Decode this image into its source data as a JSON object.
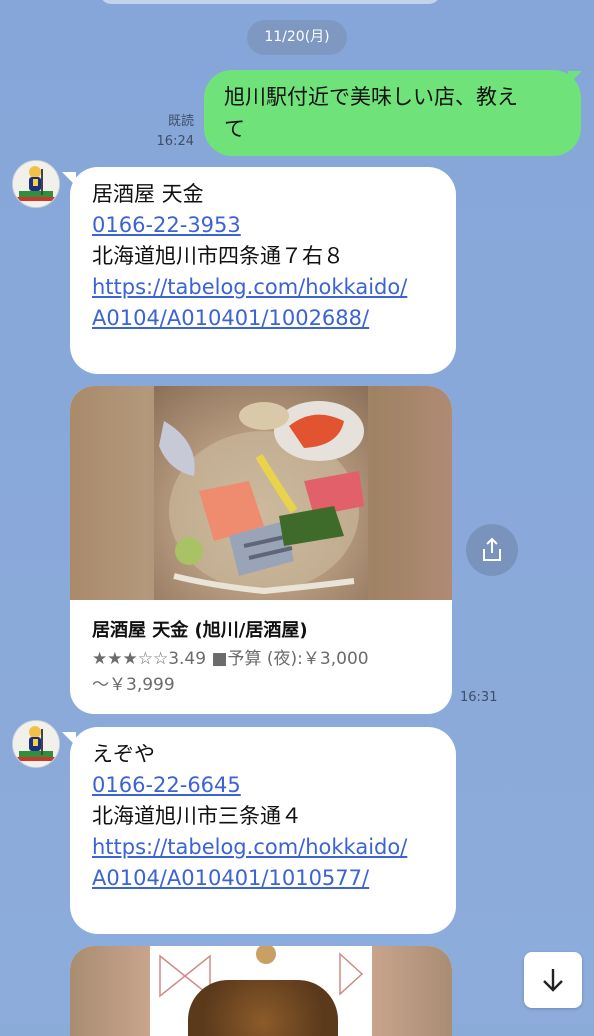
{
  "date_separator": "11/20(月)",
  "sent_message": {
    "text_line1": "旭川駅付近で美味しい店、教え",
    "text_line2": "て",
    "read_label": "既読",
    "time": "16:24"
  },
  "message1": {
    "name": "居酒屋 天金",
    "phone": "0166-22-3953",
    "address": "北海道旭川市四条通７右８",
    "url_line1": "https://tabelog.com/hokkaido/",
    "url_line2": "A0104/A010401/1002688/"
  },
  "link_card": {
    "title": "居酒屋 天金 (旭川/居酒屋)",
    "rating": 3.49,
    "description_line1": "★★★☆☆3.49 ■予算 (夜):￥3,000",
    "description_line2": "～￥3,999",
    "time": "16:31"
  },
  "message2": {
    "name": "えぞや",
    "phone": "0166-22-6645",
    "address": "北海道旭川市三条通４",
    "url_line1": "https://tabelog.com/hokkaido/",
    "url_line2": "A0104/A010401/1010577/"
  },
  "colors": {
    "chat_background": "#8aaad8",
    "sent_bubble": "#6fe37a",
    "received_bubble": "#ffffff",
    "link": "#3b63d6"
  },
  "icons": {
    "share": "share-icon",
    "scroll_down": "arrow-down-icon"
  }
}
